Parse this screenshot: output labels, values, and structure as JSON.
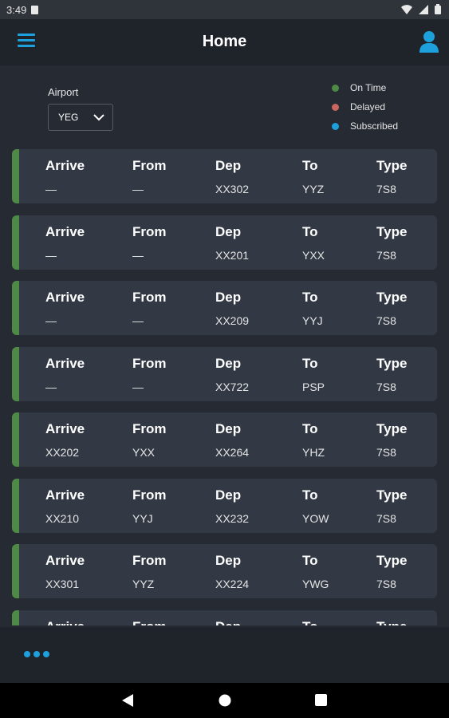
{
  "status_bar": {
    "time": "3:49"
  },
  "header": {
    "title": "Home",
    "menu_icon": "hamburger-menu-icon",
    "user_icon": "user-icon"
  },
  "filter": {
    "label": "Airport",
    "selected": "YEG"
  },
  "legend": [
    {
      "label": "On Time",
      "color": "#4e8a45"
    },
    {
      "label": "Delayed",
      "color": "#c8665f"
    },
    {
      "label": "Subscribed",
      "color": "#1ea0dc"
    }
  ],
  "columns": [
    "Arrive",
    "From",
    "Dep",
    "To",
    "Type"
  ],
  "flights": [
    {
      "arrive": "—",
      "from": "—",
      "dep": "XX302",
      "to": "YYZ",
      "type": "7S8"
    },
    {
      "arrive": "—",
      "from": "—",
      "dep": "XX201",
      "to": "YXX",
      "type": "7S8"
    },
    {
      "arrive": "—",
      "from": "—",
      "dep": "XX209",
      "to": "YYJ",
      "type": "7S8"
    },
    {
      "arrive": "—",
      "from": "—",
      "dep": "XX722",
      "to": "PSP",
      "type": "7S8"
    },
    {
      "arrive": "XX202",
      "from": "YXX",
      "dep": "XX264",
      "to": "YHZ",
      "type": "7S8"
    },
    {
      "arrive": "XX210",
      "from": "YYJ",
      "dep": "XX232",
      "to": "YOW",
      "type": "7S8"
    },
    {
      "arrive": "XX301",
      "from": "YYZ",
      "dep": "XX224",
      "to": "YWG",
      "type": "7S8"
    },
    {
      "arrive": "",
      "from": "",
      "dep": "",
      "to": "",
      "type": ""
    }
  ],
  "colors": {
    "accent": "#1ea0dc",
    "on_time": "#4e8a45",
    "card_bg": "#323944",
    "page_bg": "#252a33"
  }
}
